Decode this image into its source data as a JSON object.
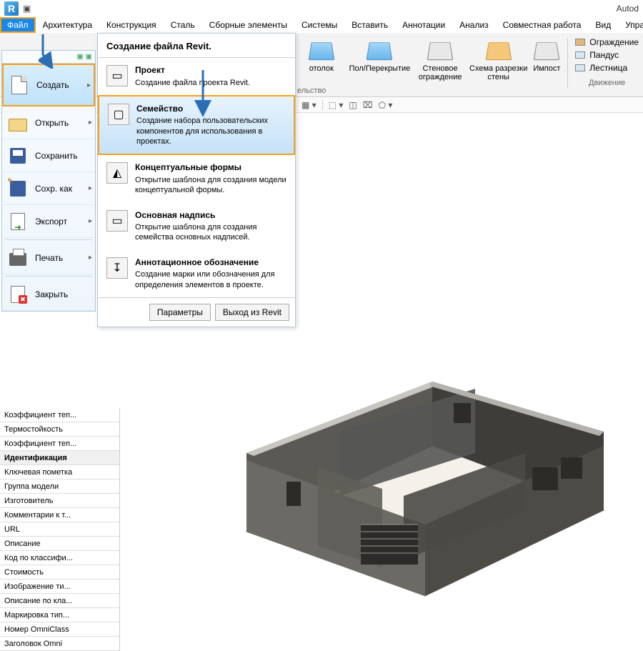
{
  "brand": "Autod",
  "tabs": {
    "file": "Файл",
    "arch": "Архитектура",
    "struct": "Конструкция",
    "steel": "Сталь",
    "precast": "Сборные элементы",
    "systems": "Системы",
    "insert": "Вставить",
    "annot": "Аннотации",
    "analyze": "Анализ",
    "collab": "Совместная работа",
    "view": "Вид",
    "manage": "Управлен"
  },
  "ribbon": {
    "ceiling": "отолок",
    "floor": "Пол/Перекрытие",
    "curtain_wall": "Стеновое ограждение",
    "curtain_grid": "Схема разрезки стены",
    "mullion": "Импост",
    "below": "ельство",
    "side": {
      "railing": "Ограждение",
      "ramp": "Пандус",
      "stair": "Лестница",
      "group": "Движение"
    }
  },
  "fileMenu": {
    "create": "Создать",
    "open": "Открыть",
    "save": "Сохранить",
    "saveas": "Сохр. как",
    "export": "Экспорт",
    "print": "Печать",
    "close": "Закрыть"
  },
  "flyout": {
    "header": "Создание файла Revit.",
    "project": {
      "title": "Проект",
      "desc": "Создание файла проекта Revit."
    },
    "family": {
      "title": "Семейство",
      "desc": "Создание набора пользовательских компонентов для использования в проектах."
    },
    "conceptual": {
      "title": "Концептуальные формы",
      "desc": "Открытие шаблона для создания модели концептуальной формы."
    },
    "titleblock": {
      "title": "Основная надпись",
      "desc": "Открытие шаблона для создания семейства основных надписей."
    },
    "annotation": {
      "title": "Аннотационное обозначение",
      "desc": "Создание марки или обозначения для определения элементов в проекте."
    },
    "options": "Параметры",
    "exit": "Выход из Revit"
  },
  "props": {
    "r0": "Коэффициент теп...",
    "r1": "Термостойкость",
    "r2": "Коэффициент теп...",
    "group": "Идентификация",
    "r3": "Ключевая пометка",
    "r4": "Группа модели",
    "r5": "Изготовитель",
    "r6": "Комментарии к т...",
    "r7": "URL",
    "r8": "Описание",
    "r9": "Код по классифи...",
    "r10": "Стоимость",
    "r11": "Изображение ти...",
    "r12": "Описание по кла...",
    "r13": "Маркировка тип...",
    "r14": "Номер OmniClass",
    "r15": "Заголовок Omni"
  }
}
